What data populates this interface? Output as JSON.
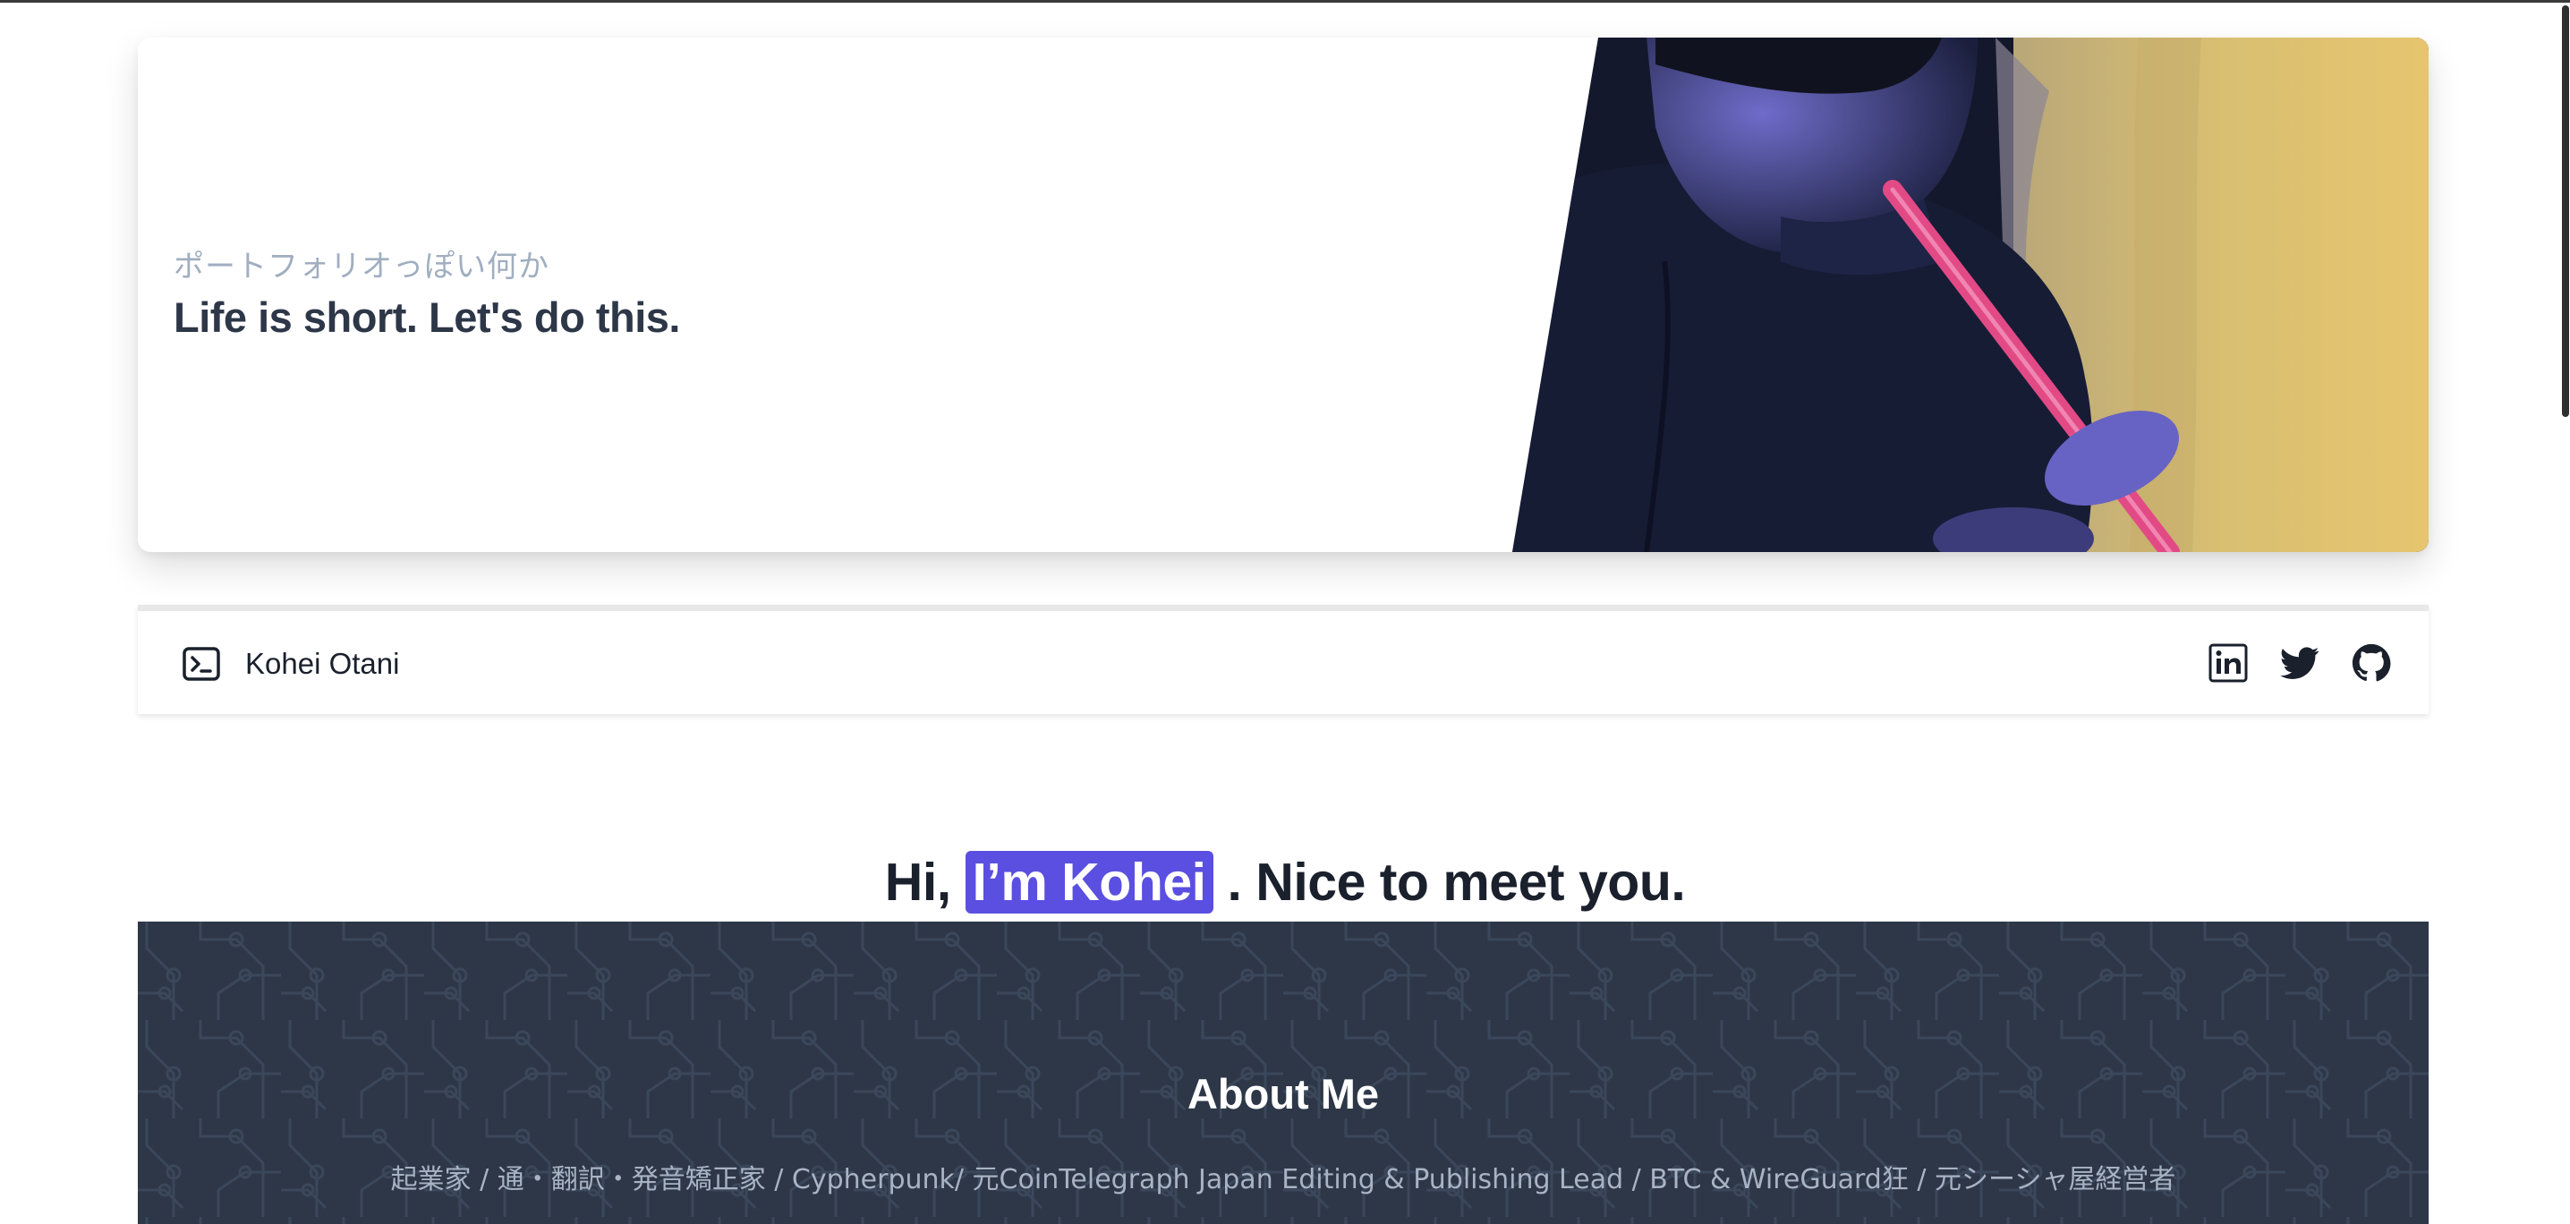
{
  "hero": {
    "subtitle": "ポートフォリオっぽい何か",
    "title": "Life is short. Let's do this."
  },
  "nav": {
    "brand_icon": "terminal-icon",
    "brand_name": "Kohei Otani",
    "social": [
      "linkedin-icon",
      "twitter-icon",
      "github-icon"
    ]
  },
  "intro": {
    "before": "Hi,",
    "highlight": "I’m Kohei",
    "after": ". Nice to meet you."
  },
  "about": {
    "title": "About Me",
    "description": "起業家 / 通・翻訳・発音矯正家 / Cypherpunk/ 元CoinTelegraph Japan Editing & Publishing Lead / BTC & WireGuard狂 / 元シーシャ屋経営者"
  },
  "colors": {
    "highlight": "#5a4fe0",
    "about_bg": "#2d3748",
    "text_dark": "#1a202c"
  }
}
